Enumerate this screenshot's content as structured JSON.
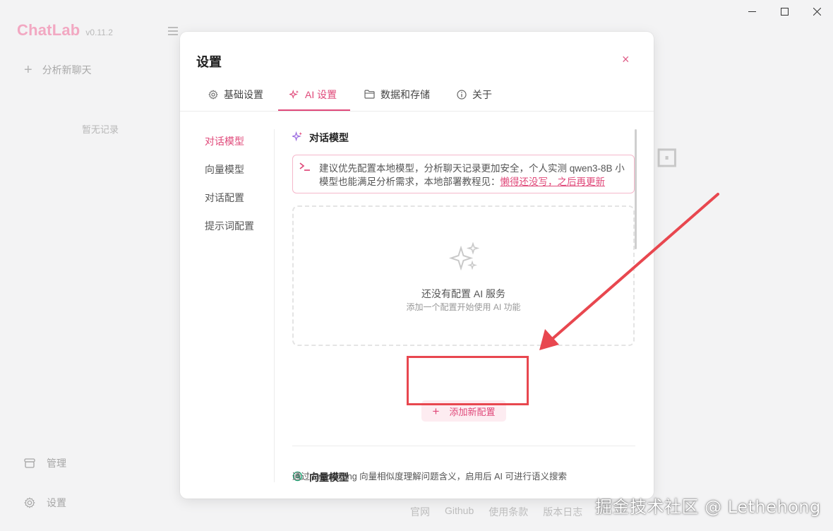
{
  "app": {
    "name": "ChatLab",
    "version": "v0.11.2",
    "new_chat_label": "分析新聊天",
    "empty_history": "暂无记录",
    "manage_label": "管理",
    "settings_label": "设置"
  },
  "footer": {
    "links": [
      "官网",
      "Github",
      "使用条款",
      "版本日志"
    ]
  },
  "watermark": "掘金技术社区 @ Lethehong",
  "dialog": {
    "title": "设置",
    "close_icon": "×",
    "tabs": [
      {
        "label": "基础设置",
        "icon": "gear-icon",
        "active": false
      },
      {
        "label": "AI 设置",
        "icon": "sparkles-icon",
        "active": true
      },
      {
        "label": "数据和存储",
        "icon": "folder-icon",
        "active": false
      },
      {
        "label": "关于",
        "icon": "info-icon",
        "active": false
      }
    ],
    "subnav": [
      {
        "label": "对话模型",
        "active": true
      },
      {
        "label": "向量模型",
        "active": false
      },
      {
        "label": "对话配置",
        "active": false
      },
      {
        "label": "提示词配置",
        "active": false
      }
    ],
    "chat_section": {
      "title": "对话模型",
      "notice_text": "建议优先配置本地模型，分析聊天记录更加安全，个人实测 qwen3-8B 小模型也能满足分析需求，本地部署教程见：",
      "notice_link": "懒得还没写，之后再更新",
      "empty_title": "还没有配置 AI 服务",
      "empty_subtitle": "添加一个配置开始使用 AI 功能",
      "add_button": "添加新配置"
    },
    "embed_section": {
      "title": "向量模型",
      "description": "通过 Embedding 向量相似度理解问题含义，启用后 AI 可进行语义搜索"
    }
  },
  "colors": {
    "accent": "#e0497a",
    "accent_soft": "#fdecf1",
    "annotation": "#e8474f"
  }
}
